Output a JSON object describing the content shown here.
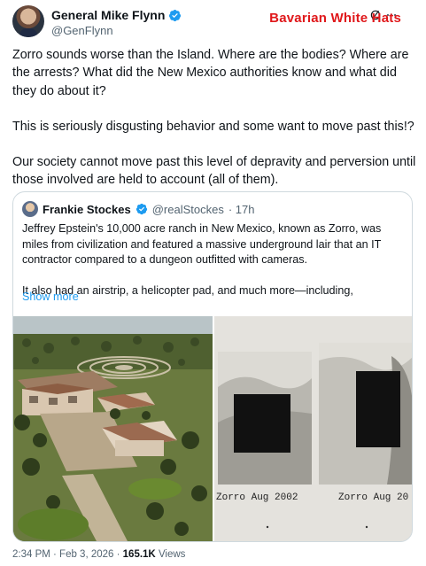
{
  "author": {
    "name": "General Mike Flynn",
    "handle": "@GenFlynn"
  },
  "watermark": "Bavarian White Hats",
  "icons": [
    "grok-icon",
    "more-icon",
    "verified-badge-icon"
  ],
  "tweet": {
    "paragraphs": [
      "Zorro sounds worse than the Island. Where are the bodies? Where are the arrests? What did the New Mexico authorities know and what did they do about it?",
      "This is seriously disgusting behavior and some want to move past this!?",
      "Our society cannot move past this level of depravity and perversion until those involved are held to account (all of them)."
    ]
  },
  "quote": {
    "name": "Frankie Stockes",
    "handle": "@realStockes",
    "time": "· 17h",
    "paragraphs": [
      "Jeffrey Epstein's 10,000 acre ranch in New Mexico, known as Zorro, was miles from civilization and featured a massive underground lair that an IT contractor compared to a dungeon outfitted with cameras.",
      "It also had an airstrip, a helicopter pad, and much more—including,"
    ],
    "show_more": "Show more",
    "captions": [
      "Zorro Aug 2002",
      "Zorro Aug 20"
    ]
  },
  "footer": {
    "time": "2:34 PM · Feb 3, 2026 · ",
    "views_count": "165.1K",
    "views_label": " Views"
  },
  "colors": {
    "accent": "#1d9bf0",
    "watermark": "#e0181b",
    "secondary_text": "#536471"
  }
}
